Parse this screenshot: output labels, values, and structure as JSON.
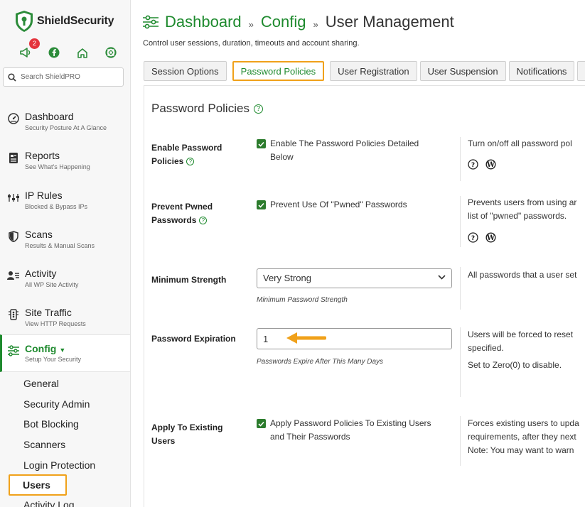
{
  "app": {
    "brand": "ShieldSecurity",
    "notification_count": "2",
    "search_placeholder": "Search ShieldPRO",
    "accent": "#1e8a2e",
    "highlight": "#f0a11a"
  },
  "sidebar": {
    "nav": [
      {
        "title": "Dashboard",
        "sub": "Security Posture At A Glance",
        "icon": "gauge-icon"
      },
      {
        "title": "Reports",
        "sub": "See What's Happening",
        "icon": "report-icon"
      },
      {
        "title": "IP Rules",
        "sub": "Blocked & Bypass IPs",
        "icon": "ip-rules-icon"
      },
      {
        "title": "Scans",
        "sub": "Results & Manual Scans",
        "icon": "shield-icon"
      },
      {
        "title": "Activity",
        "sub": "All WP Site Activity",
        "icon": "activity-icon"
      },
      {
        "title": "Site Traffic",
        "sub": "View HTTP Requests",
        "icon": "traffic-icon"
      },
      {
        "title": "Config",
        "sub": "Setup Your Security",
        "icon": "sliders-icon"
      }
    ],
    "subnav": [
      "General",
      "Security Admin",
      "Bot Blocking",
      "Scanners",
      "Login Protection",
      "Users",
      "Activity Log"
    ]
  },
  "header": {
    "crumbs": [
      "Dashboard",
      "Config",
      "User Management"
    ],
    "separator": "»",
    "subtitle": "Control user sessions, duration, timeouts and account sharing."
  },
  "tabs": [
    "Session Options",
    "Password Policies",
    "User Registration",
    "User Suspension",
    "Notifications",
    "C"
  ],
  "panel": {
    "title": "Password Policies",
    "rows": {
      "enable": {
        "label1": "Enable Password",
        "label2": "Policies",
        "check1": "Enable The Password Policies Detailed",
        "check2": "Below",
        "desc1": "Turn on/off all password pol"
      },
      "pwned": {
        "label1": "Prevent Pwned",
        "label2": "Passwords",
        "check1": "Prevent Use Of \"Pwned\" Passwords",
        "desc1": "Prevents users from using ar",
        "desc2": "list of \"pwned\" passwords."
      },
      "strength": {
        "label1": "Minimum Strength",
        "value": "Very Strong",
        "hint": "Minimum Password Strength",
        "desc1": "All passwords that a user set"
      },
      "expiration": {
        "label1": "Password Expiration",
        "value": "1",
        "hint": "Passwords Expire After This Many Days",
        "desc1": "Users will be forced to reset",
        "desc2": "specified.",
        "desc3": "Set to Zero(0) to disable."
      },
      "existing": {
        "label1": "Apply To Existing",
        "label2": "Users",
        "check1": "Apply Password Policies To Existing Users",
        "check2": "and Their Passwords",
        "desc1": "Forces existing users to upda",
        "desc2": "requirements, after they next",
        "desc3": "Note: You may want to warn"
      }
    }
  }
}
